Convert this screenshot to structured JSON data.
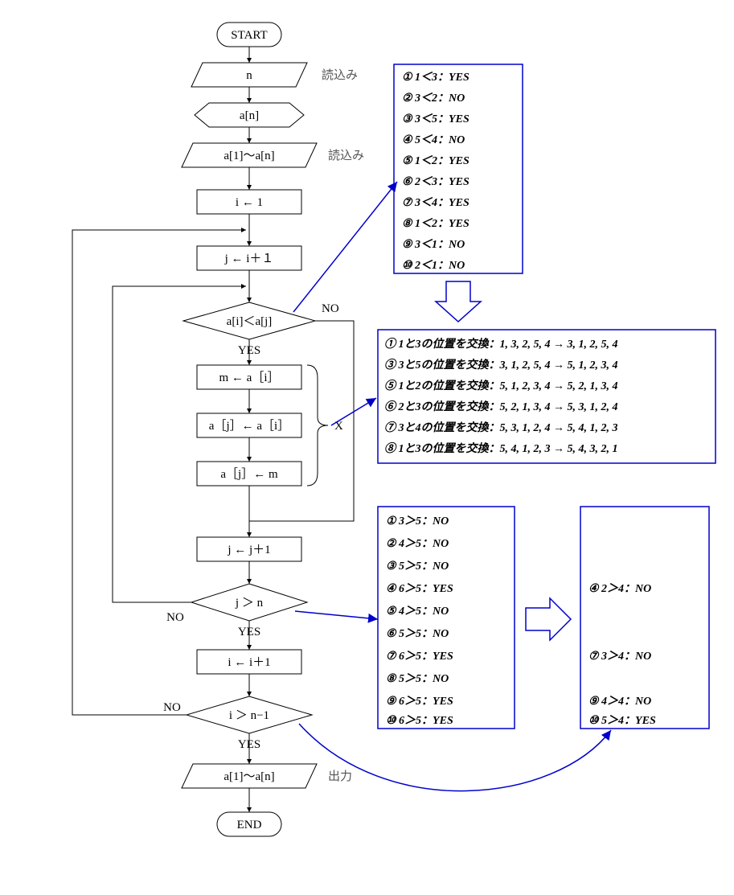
{
  "flow": {
    "start": "START",
    "input_n": "n",
    "input_n_label": "読込み",
    "prep_a": "a[n]",
    "input_arr": "a[1]～a[n]",
    "input_arr_label": "読込み",
    "i_init": "i ← 1",
    "j_init": "j ← i＋１",
    "cmp": "a[i]＜a[j]",
    "cmp_yes": "YES",
    "cmp_no": "NO",
    "m_assign": "m ← a［i］",
    "aj_ai": "a［j］← a［i］",
    "aj_m": "a［j］← m",
    "x_label": "X",
    "j_inc": "j ← j＋1",
    "jloop": "j ＞ n",
    "jloop_yes": "YES",
    "jloop_no": "NO",
    "i_inc": "i ← i＋1",
    "iloop": "i ＞ n−1",
    "iloop_yes": "YES",
    "iloop_no": "NO",
    "output": "a[1]～a[n]",
    "output_label": "出力",
    "end": "END"
  },
  "box1": [
    "① 1＜3：YES",
    "② 3＜2：NO",
    "③ 3＜5：YES",
    "④ 5＜4：NO",
    "⑤ 1＜2：YES",
    "⑥ 2＜3：YES",
    "⑦ 3＜4：YES",
    "⑧ 1＜2：YES",
    "⑨ 3＜1：NO",
    "⑩ 2＜1：NO"
  ],
  "box2": [
    "① 1と3の位置を交換：1, 3, 2, 5, 4 → 3, 1, 2, 5, 4",
    "③ 3と5の位置を交換：3, 1, 2, 5, 4 → 5, 1, 2, 3, 4",
    "⑤ 1と2の位置を交換：5, 1, 2, 3, 4 → 5, 2, 1, 3, 4",
    "⑥ 2と3の位置を交換：5, 2, 1, 3, 4 → 5, 3, 1, 2, 4",
    "⑦ 3と4の位置を交換：5, 3, 1, 2, 4 → 5, 4, 1, 2, 3",
    "⑧ 1と3の位置を交換：5, 4, 1, 2, 3 → 5, 4, 3, 2, 1"
  ],
  "box3": [
    "① 3＞5：NO",
    "② 4＞5：NO",
    "③ 5＞5：NO",
    "④ 6＞5：YES",
    "⑤ 4＞5：NO",
    "⑥ 5＞5：NO",
    "⑦ 6＞5：YES",
    "⑧ 5＞5：NO",
    "⑨ 6＞5：YES",
    "⑩ 6＞5：YES"
  ],
  "box4": [
    "④ 2＞4：NO",
    "",
    "",
    "⑦ 3＞4：NO",
    "",
    "⑨ 4＞4：NO",
    "⑩ 5＞4：YES"
  ]
}
